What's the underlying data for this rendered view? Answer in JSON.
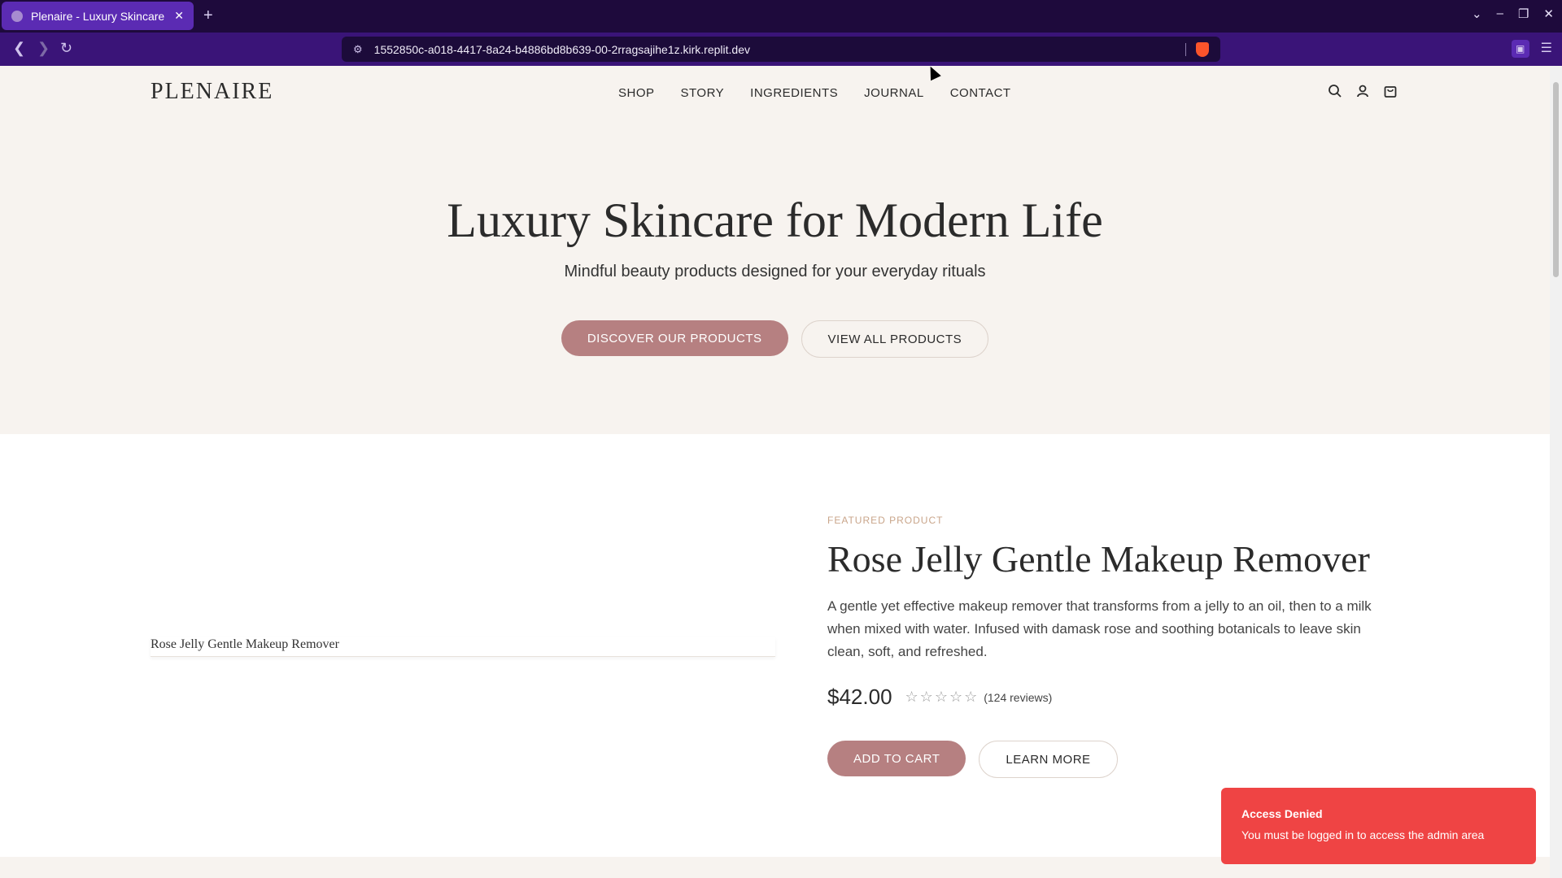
{
  "browser": {
    "tab_title": "Plenaire - Luxury Skincare",
    "url": "1552850c-a018-4417-8a24-b4886bd8b639-00-2rragsajihe1z.kirk.replit.dev"
  },
  "header": {
    "logo": "PLENAIRE",
    "nav": [
      "SHOP",
      "STORY",
      "INGREDIENTS",
      "JOURNAL",
      "CONTACT"
    ],
    "icons": [
      "search-icon",
      "account-icon",
      "cart-icon"
    ]
  },
  "hero": {
    "title": "Luxury Skincare for Modern Life",
    "subtitle": "Mindful beauty products designed for your everyday rituals",
    "primary_button": "DISCOVER OUR PRODUCTS",
    "secondary_button": "VIEW ALL PRODUCTS"
  },
  "featured": {
    "image_alt": "Rose Jelly Gentle Makeup Remover",
    "eyebrow": "FEATURED PRODUCT",
    "title": "Rose Jelly Gentle Makeup Remover",
    "description": "A gentle yet effective makeup remover that transforms from a jelly to an oil, then to a milk when mixed with water. Infused with damask rose and soothing botanicals to leave skin clean, soft, and refreshed.",
    "price": "$42.00",
    "rating": 0,
    "rating_max": 5,
    "reviews": "(124 reviews)",
    "add_to_cart": "ADD TO CART",
    "learn_more": "LEARN MORE"
  },
  "toast": {
    "title": "Access Denied",
    "message": "You must be logged in to access the admin area"
  },
  "colors": {
    "accent": "#b68081",
    "toast": "#ef4444",
    "browser_tabbar": "#1e0a3c",
    "browser_addressbar": "#3a1478"
  }
}
